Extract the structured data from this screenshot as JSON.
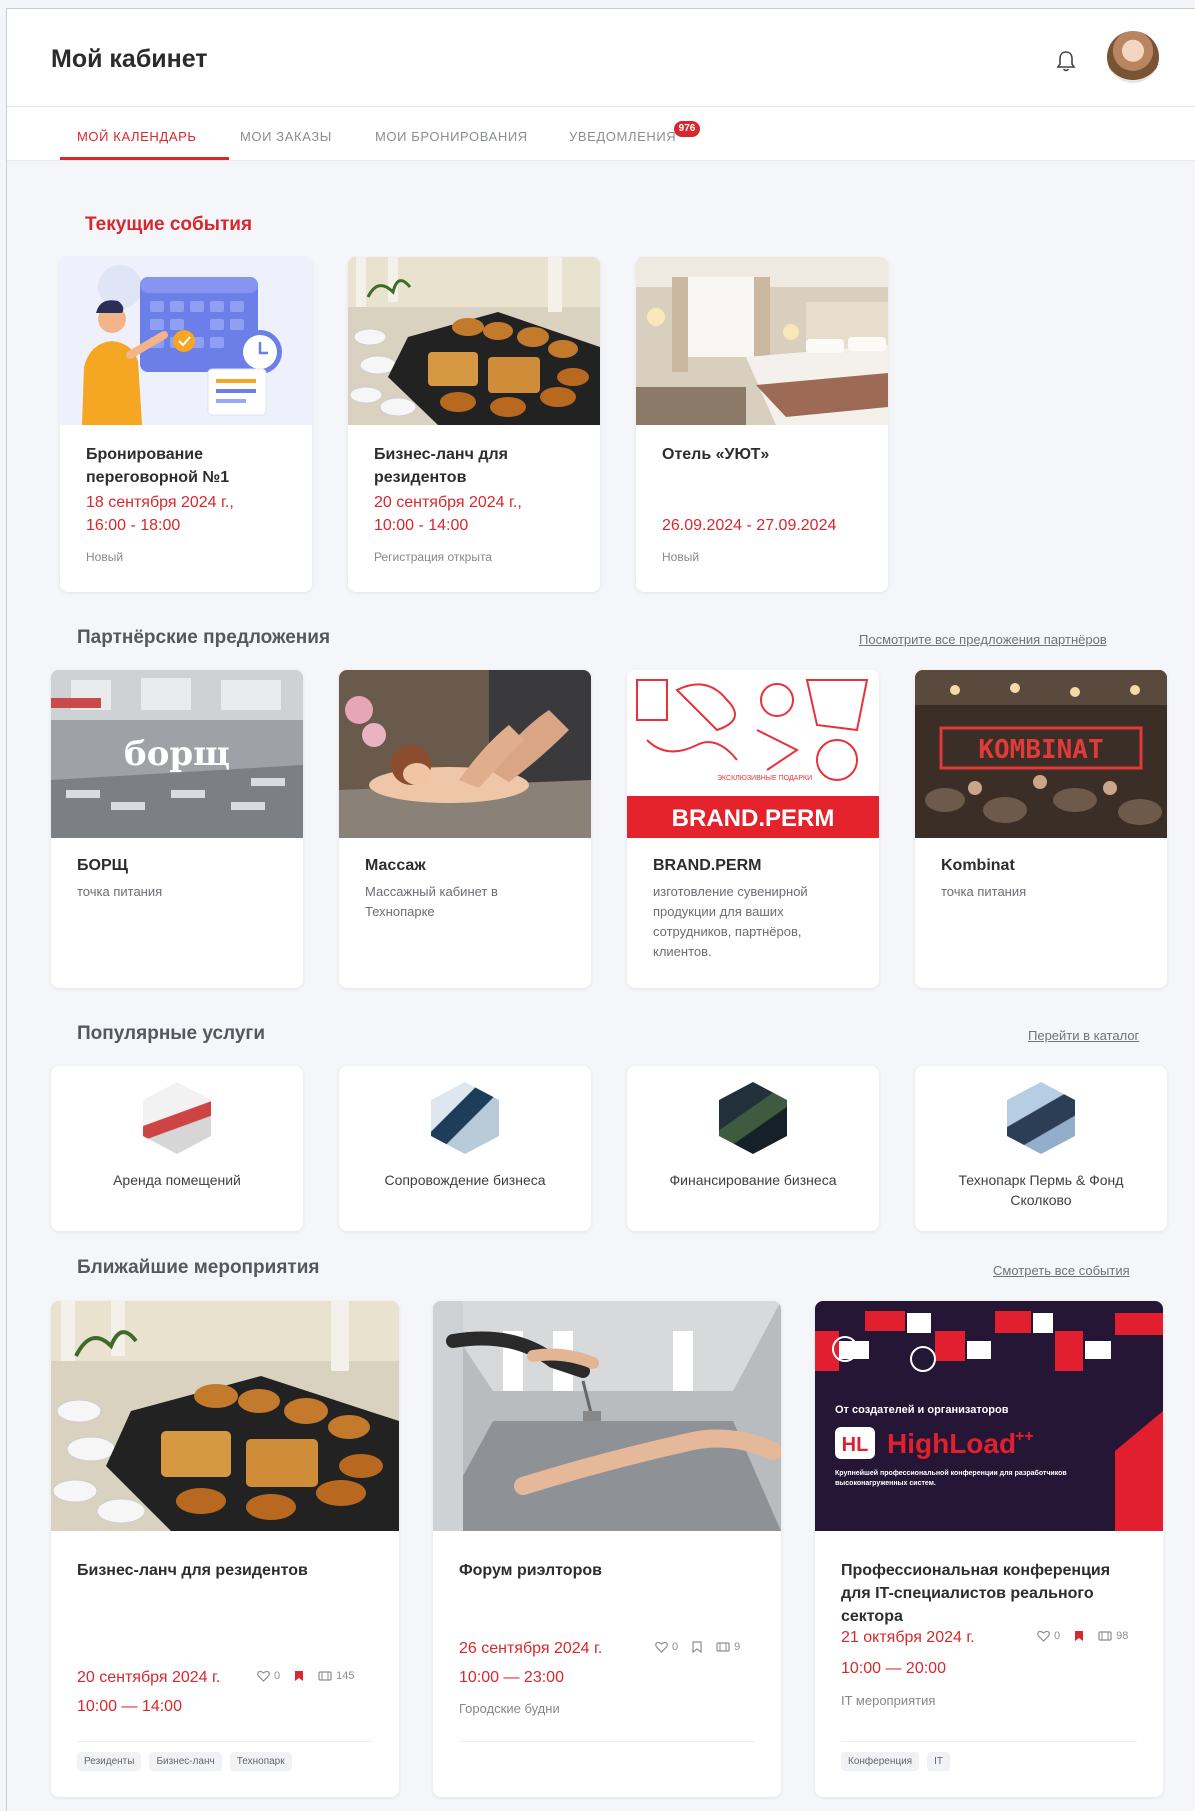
{
  "header": {
    "title": "Мой кабинет"
  },
  "tabs": [
    {
      "label": "МОЙ КАЛЕНДАРЬ"
    },
    {
      "label": "МОИ ЗАКАЗЫ"
    },
    {
      "label": "МОИ БРОНИРОВАНИЯ"
    },
    {
      "label": "УВЕДОМЛЕНИЯ",
      "badge": "976"
    }
  ],
  "current": {
    "title": "Текущие события",
    "cards": [
      {
        "title": "Бронирование переговорной №1",
        "date": "18 сентября 2024 г.,",
        "time": "16:00 - 18:00",
        "status": "Новый"
      },
      {
        "title": "Бизнес-ланч для резидентов",
        "date": "20 сентября 2024 г.,",
        "time": "10:00 - 14:00",
        "status": "Регистрация открыта"
      },
      {
        "title": "Отель «УЮТ»",
        "date": "26.09.2024 - 27.09.2024",
        "status": "Новый"
      }
    ]
  },
  "partners": {
    "title": "Партнёрские предложения",
    "link": "Посмотрите все предложения партнёров",
    "cards": [
      {
        "title": "БОРЩ",
        "desc": "точка питания",
        "logo": "борщ"
      },
      {
        "title": "Массаж",
        "desc": "Массажный кабинет в Технопарке"
      },
      {
        "title": "BRAND.PERM",
        "desc": "изготовление сувенирной продукции для ваших сотрудников, партнёров, клиентов.",
        "logo": "BRAND.PERM"
      },
      {
        "title": "Kombinat",
        "desc": "точка питания",
        "logo": "KOMBINAT"
      }
    ]
  },
  "services": {
    "title": "Популярные услуги",
    "link": "Перейти в каталог",
    "items": [
      {
        "label": "Аренда помещений"
      },
      {
        "label": "Сопровождение бизнеса"
      },
      {
        "label": "Финансирование бизнеса"
      },
      {
        "label": "Технопарк Пермь & Фонд Сколково"
      }
    ]
  },
  "events": {
    "title": "Ближайшие мероприятия",
    "link": "Смотреть все события",
    "cards": [
      {
        "title": "Бизнес-ланч для резидентов",
        "date": "20 сентября 2024 г.",
        "time": "10:00 — 14:00",
        "likes": "0",
        "views": "145",
        "tags": [
          "Резиденты",
          "Бизнес-ланч",
          "Технопарк"
        ]
      },
      {
        "title": "Форум риэлторов",
        "date": "26 сентября 2024 г.",
        "time": "10:00 — 23:00",
        "likes": "0",
        "views": "9",
        "category": "Городские будни"
      },
      {
        "title": "Профессиональная конференция для IT-специалистов реального сектора",
        "date": "21 октября 2024 г.",
        "time": "10:00 — 20:00",
        "likes": "0",
        "views": "98",
        "category": "IT мероприятия",
        "tags": [
          "Конференция",
          "IT"
        ],
        "promo": {
          "line1": "От создателей и организаторов",
          "brand": "HighLoad",
          "brand_suffix": "++",
          "line2": "Крупнейшей профессиональной конференции для разработчиков высоконагруженных систем."
        }
      }
    ]
  },
  "colors": {
    "accent": "#d8272d"
  }
}
